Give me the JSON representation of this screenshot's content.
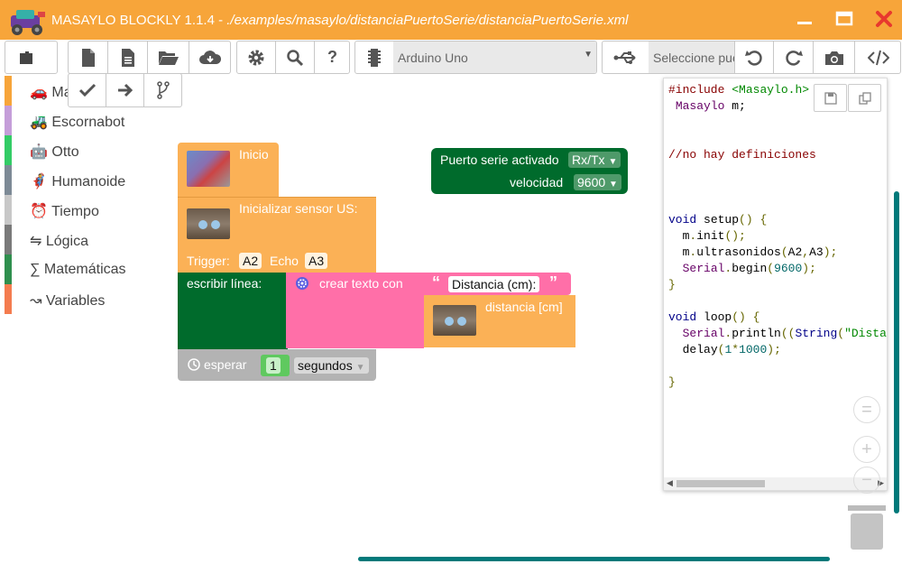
{
  "window": {
    "app_title": "MASAYLO BLOCKLY 1.1.4 - ",
    "file_path": "./examples/masaylo/distanciaPuertoSerie/distanciaPuertoSerie.xml",
    "titlebar_color": "#f7a53a"
  },
  "toolbar": {
    "board_select": "Arduino Uno",
    "port_placeholder": "Seleccione puerto"
  },
  "categories": [
    {
      "icon": "🚗",
      "label": "Ma",
      "color": "#f7a53a"
    },
    {
      "icon": "🚜",
      "label": "Escornabot",
      "color": "#c59ed9"
    },
    {
      "icon": "🤖",
      "label": "Otto",
      "color": "#33cc66"
    },
    {
      "icon": "🦸",
      "label": "Humanoide",
      "color": "#7d8a96"
    },
    {
      "icon": "⏰",
      "label": "Tiempo",
      "color": "#c8c8c8"
    },
    {
      "icon": "⇋",
      "label": "Lógica",
      "color": "#7a7a7a"
    },
    {
      "icon": "∑",
      "label": "Matemáticas",
      "color": "#2f8f4e"
    },
    {
      "icon": "↝",
      "label": "Variables",
      "color": "#f47c4f"
    }
  ],
  "blocks": {
    "inicio": "Inicio",
    "init_sensor": "Inicializar sensor US:",
    "trigger_label": "Trigger:",
    "trigger_value": "A2",
    "echo_label": "Echo",
    "echo_value": "A3",
    "serial_label": "Puerto serie activado",
    "serial_mode": "Rx/Tx",
    "speed_label": "velocidad",
    "speed_value": "9600",
    "print_line": "escribir línea:",
    "create_text": "crear texto con",
    "text_value": "Distancia (cm):",
    "distance_label": "distancia [cm]",
    "wait_label": "esperar",
    "wait_value": "1",
    "wait_unit": "segundos",
    "orange": "#fbb156",
    "green": "#006b2c",
    "green_dark": "#00692e",
    "pink": "#ff6fa8",
    "grey": "#b3b3b3"
  },
  "code": {
    "l1a": "#include",
    "l1b": "<Masaylo.h>",
    "l2a": "Masaylo",
    "l2b": "m;",
    "l3": "//no hay definiciones",
    "l4a": "void",
    "l4b": "setup",
    "l4c": "() {",
    "l5a": "m",
    "l5b": ".",
    "l5c": "init",
    "l5d": "();",
    "l6a": "m",
    "l6b": ".",
    "l6c": "ultrasonidos",
    "l6d": "(",
    "l6e": "A2",
    "l6f": ",",
    "l6g": "A3",
    "l6h": ");",
    "l7a": "Serial",
    "l7b": ".",
    "l7c": "begin",
    "l7d": "(",
    "l7e": "9600",
    "l7f": ");",
    "l8": "}",
    "l9a": "void",
    "l9b": "loop",
    "l9c": "() {",
    "l10a": "Serial",
    "l10b": ".",
    "l10c": "println",
    "l10d": "((",
    "l10e": "String",
    "l10f": "(",
    "l10g": "\"Dista",
    "l11a": "delay",
    "l11b": "(",
    "l11c": "1",
    "l11d": "*",
    "l11e": "1000",
    "l11f": ");",
    "l12": "}"
  }
}
